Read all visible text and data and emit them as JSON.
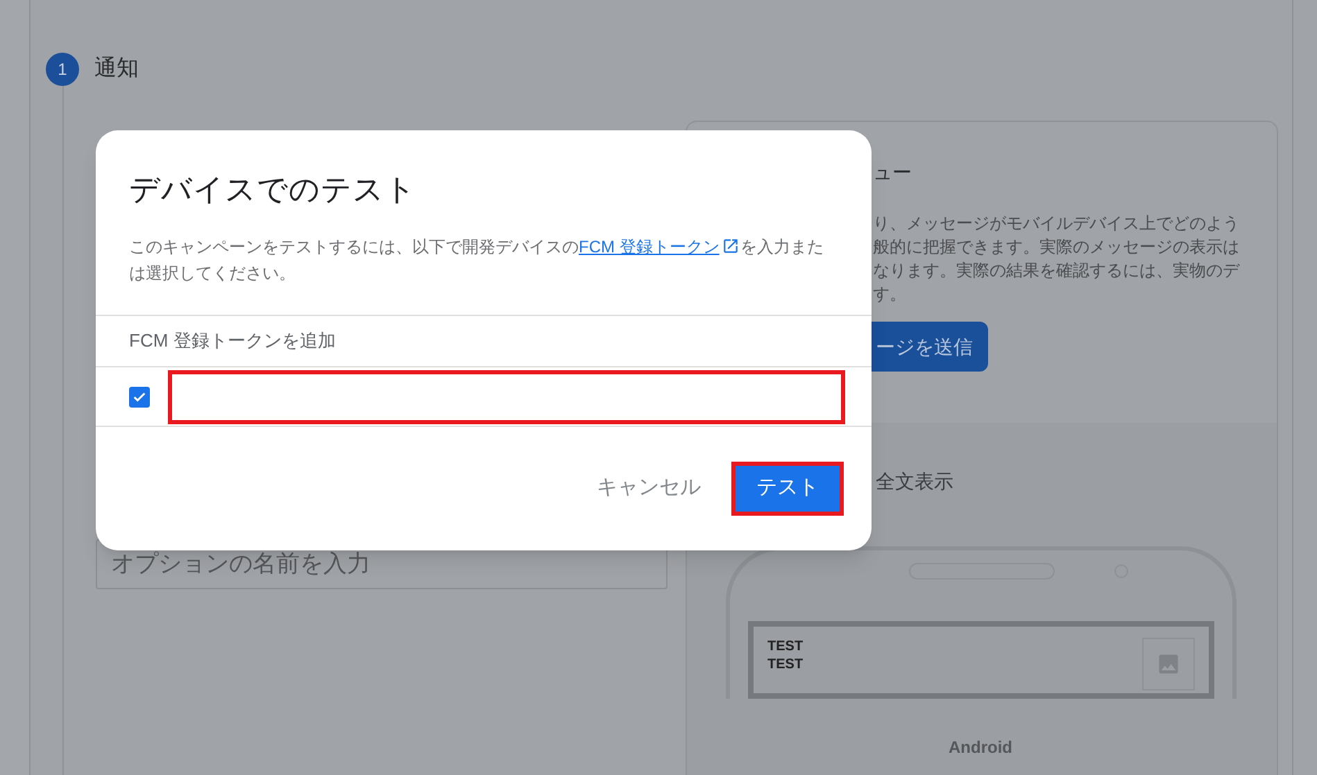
{
  "step": {
    "number": "1",
    "title": "通知"
  },
  "option_field": {
    "placeholder": "オプションの名前を入力"
  },
  "preview": {
    "heading": "ュー",
    "text_lines": [
      "り、メッセージがモバイルデバイス上でどのよう",
      "般的に把握できます。実際のメッセージの表示は",
      "なります。実際の結果を確認するには、実物のデ",
      "す。"
    ],
    "send_button": "ージを送信",
    "full_view": "全文表示",
    "notification": {
      "title": "TEST",
      "body": "TEST"
    },
    "platform": "Android"
  },
  "dialog": {
    "title": "デバイスでのテスト",
    "description_before": "このキャンペーンをテストするには、以下で開発デバイスの",
    "link": "FCM 登録トークン",
    "description_after": "を入力または選択してください。",
    "section_label": "FCM 登録トークンを追加",
    "tokens": [
      {
        "checked": true
      }
    ],
    "buttons": [
      {
        "label": "キャンセル",
        "kind": "text"
      },
      {
        "label": "テスト",
        "kind": "primary"
      }
    ]
  }
}
